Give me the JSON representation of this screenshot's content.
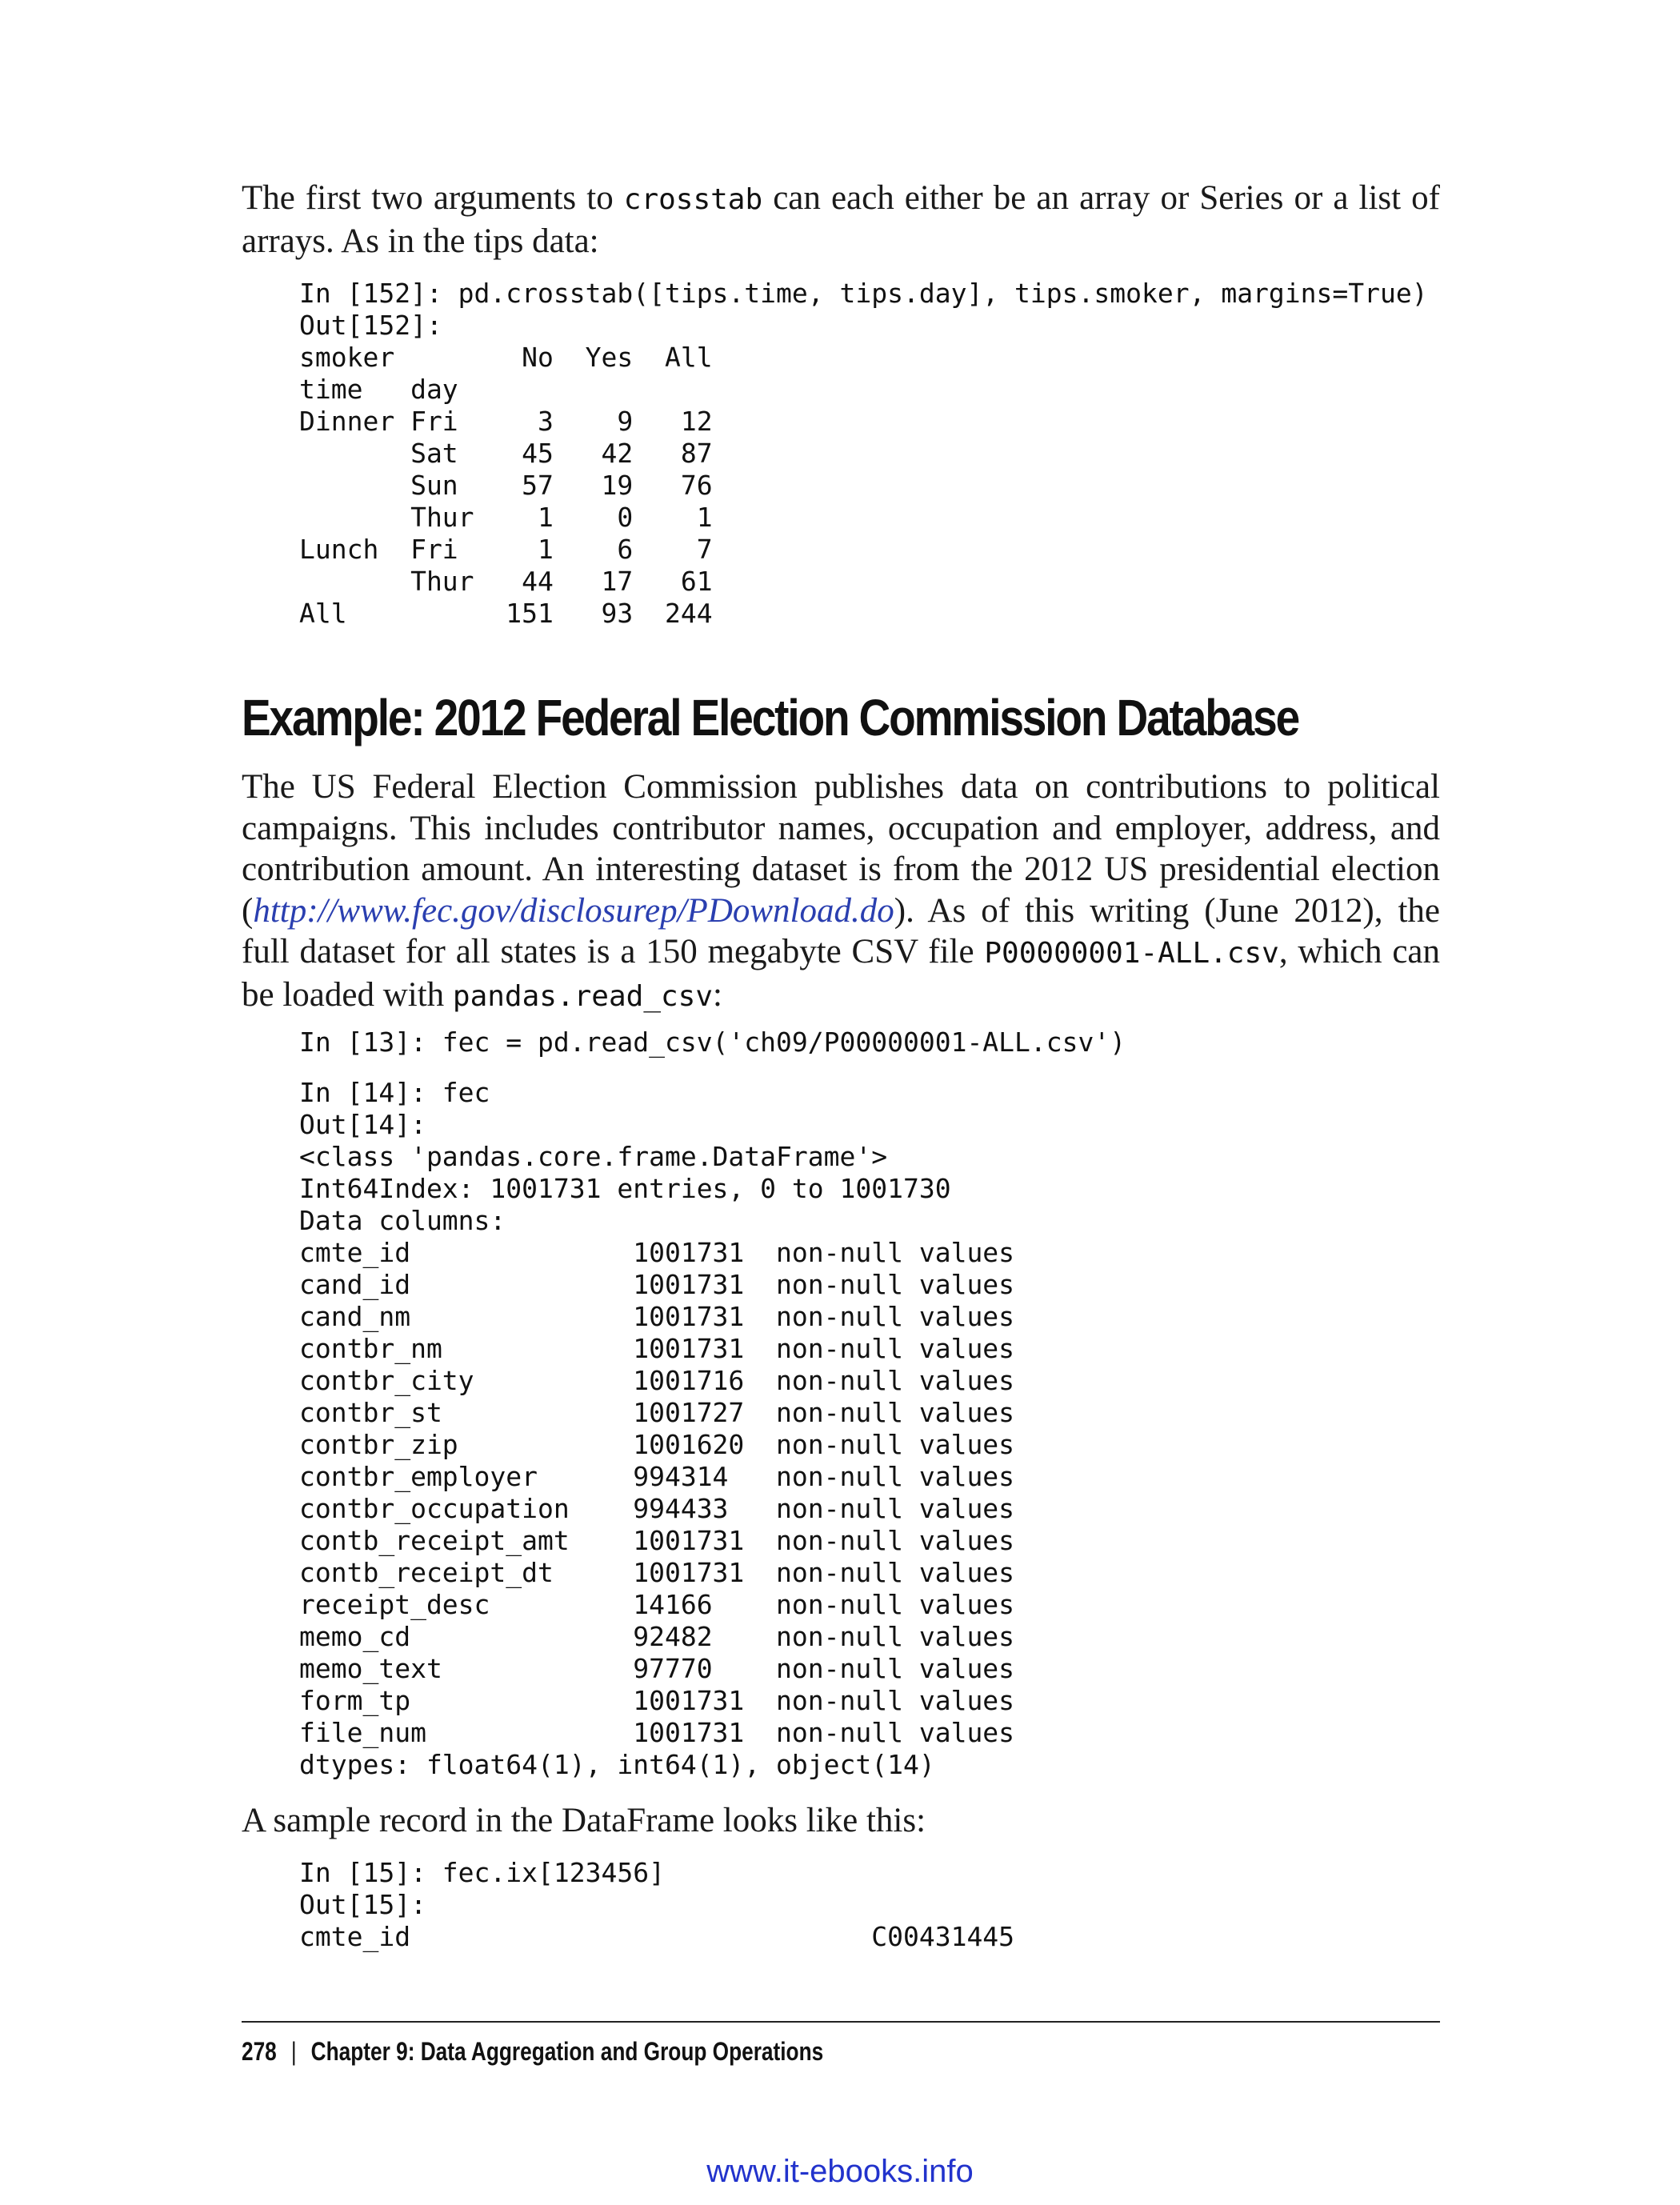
{
  "intro": {
    "t1": "The first two arguments to ",
    "code1": "crosstab",
    "t2": " can each either be an array or Series or a list of arrays. As in the tips data:"
  },
  "code_crosstab": "In [152]: pd.crosstab([tips.time, tips.day], tips.smoker, margins=True)\nOut[152]:\nsmoker        No  Yes  All\ntime   day\nDinner Fri     3    9   12\n       Sat    45   42   87\n       Sun    57   19   76\n       Thur    1    0    1\nLunch  Fri     1    6    7\n       Thur   44   17   61\nAll          151   93  244",
  "section_title": "Example: 2012 Federal Election Commission Database",
  "para_fec": {
    "t1": "The US Federal Election Commission publishes data on contributions to political campaigns. This includes contributor names, occupation and employer, address, and contribution amount. An interesting dataset is from the 2012 US presidential election (",
    "link": "http://www.fec.gov/disclosurep/PDownload.do",
    "t2": "). As of this writing (June 2012), the full dataset for all states is a 150 megabyte CSV file ",
    "code1": "P00000001-ALL.csv",
    "t3": ", which can be loaded with ",
    "code2": "pandas.read_csv",
    "t4": ":"
  },
  "code_read": "In [13]: fec = pd.read_csv('ch09/P00000001-ALL.csv')",
  "code_info": "In [14]: fec\nOut[14]:\n<class 'pandas.core.frame.DataFrame'>\nInt64Index: 1001731 entries, 0 to 1001730\nData columns:\ncmte_id              1001731  non-null values\ncand_id              1001731  non-null values\ncand_nm              1001731  non-null values\ncontbr_nm            1001731  non-null values\ncontbr_city          1001716  non-null values\ncontbr_st            1001727  non-null values\ncontbr_zip           1001620  non-null values\ncontbr_employer      994314   non-null values\ncontbr_occupation    994433   non-null values\ncontb_receipt_amt    1001731  non-null values\ncontb_receipt_dt     1001731  non-null values\nreceipt_desc         14166    non-null values\nmemo_cd              92482    non-null values\nmemo_text            97770    non-null values\nform_tp              1001731  non-null values\nfile_num             1001731  non-null values\ndtypes: float64(1), int64(1), object(14)",
  "sample_text": "A sample record in the DataFrame looks like this:",
  "code_sample": "In [15]: fec.ix[123456]\nOut[15]:\ncmte_id                             C00431445",
  "footer": {
    "page_number": "278",
    "separator": "|",
    "chapter": "Chapter 9: Data Aggregation and Group Operations"
  },
  "watermark": "www.it-ebooks.info"
}
